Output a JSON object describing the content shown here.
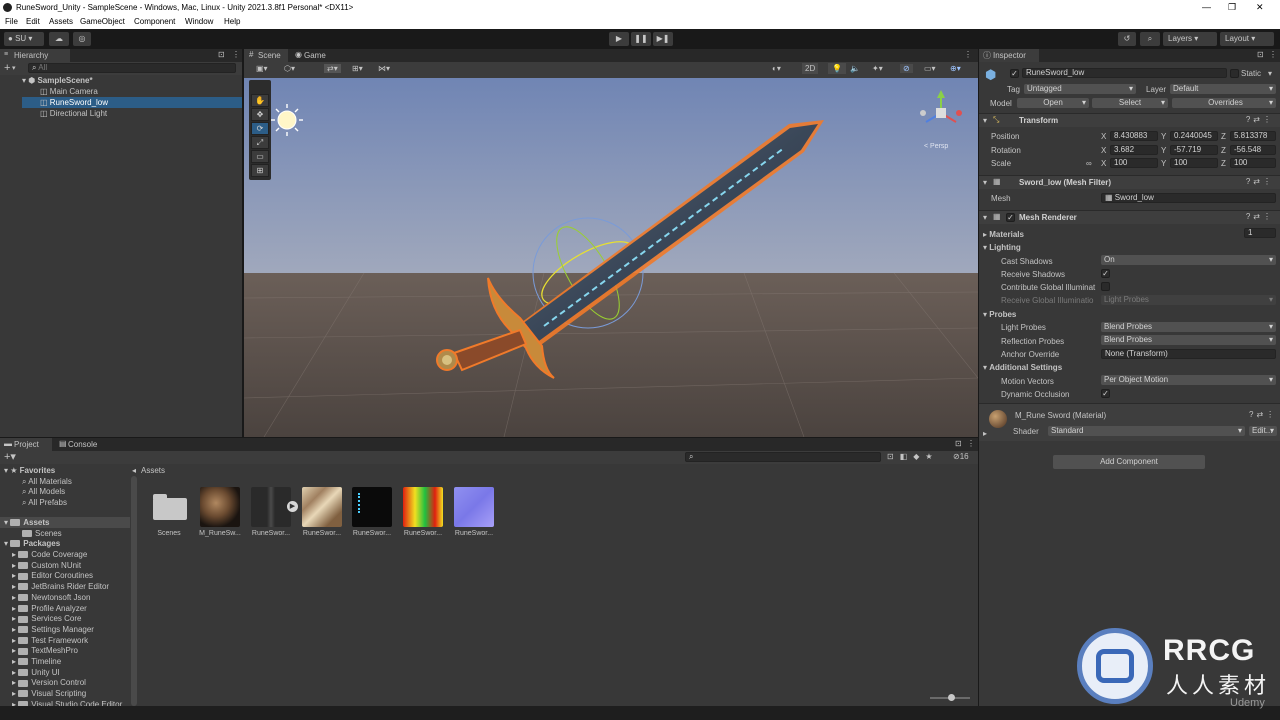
{
  "window": {
    "title": "RuneSword_Unity - SampleScene - Windows, Mac, Linux - Unity 2021.3.8f1 Personal* <DX11>",
    "controls": [
      "—",
      "❐",
      "✕"
    ]
  },
  "menu": [
    "File",
    "Edit",
    "Assets",
    "GameObject",
    "Component",
    "Window",
    "Help"
  ],
  "toolbar": {
    "account": "SU",
    "play_icon": "▶",
    "pause_icon": "❚❚",
    "step_icon": "▶❚",
    "layers": "Layers",
    "layout": "Layout"
  },
  "hierarchy": {
    "tab": "Hierarchy",
    "search_placeholder": "All",
    "scene": "SampleScene*",
    "items": [
      "Main Camera",
      "RuneSword_low",
      "Directional Light"
    ]
  },
  "scene_view": {
    "tabs": [
      "Scene",
      "Game"
    ],
    "mode_2d": "2D",
    "tools": [
      "✋",
      "✥",
      "⟳",
      "⤢",
      "▭",
      "⊞"
    ],
    "gizmo_label": "< Persp"
  },
  "inspector": {
    "tab": "Inspector",
    "object_name": "RuneSword_low",
    "static": "Static",
    "tag_label": "Tag",
    "tag_value": "Untagged",
    "layer_label": "Layer",
    "layer_value": "Default",
    "model_label": "Model",
    "model_buttons": [
      "Open",
      "Select",
      "Overrides"
    ],
    "transform": {
      "title": "Transform",
      "position_label": "Position",
      "rotation_label": "Rotation",
      "scale_label": "Scale",
      "axes": [
        "X",
        "Y",
        "Z"
      ],
      "position": [
        "8.430883",
        "0.2440045",
        "5.813378"
      ],
      "rotation": [
        "3.682",
        "-57.719",
        "-56.548"
      ],
      "scale": [
        "100",
        "100",
        "100"
      ]
    },
    "mesh_filter": {
      "title": "Sword_low (Mesh Filter)",
      "mesh_label": "Mesh",
      "mesh_value": "Sword_low"
    },
    "mesh_renderer": {
      "title": "Mesh Renderer",
      "materials_label": "Materials",
      "materials_count": "1",
      "lighting_label": "Lighting",
      "cast_shadows_label": "Cast Shadows",
      "cast_shadows_value": "On",
      "receive_shadows_label": "Receive Shadows",
      "contribute_gi_label": "Contribute Global Illuminat",
      "receive_gi_label": "Receive Global Illuminatio",
      "receive_gi_value": "Light Probes",
      "probes_label": "Probes",
      "light_probes_label": "Light Probes",
      "light_probes_value": "Blend Probes",
      "reflection_probes_label": "Reflection Probes",
      "reflection_probes_value": "Blend Probes",
      "anchor_override_label": "Anchor Override",
      "anchor_override_value": "None (Transform)",
      "additional_label": "Additional Settings",
      "motion_vectors_label": "Motion Vectors",
      "motion_vectors_value": "Per Object Motion",
      "dynamic_occlusion_label": "Dynamic Occlusion"
    },
    "material": {
      "name": "M_Rune Sword (Material)",
      "shader_label": "Shader",
      "shader_value": "Standard",
      "edit_button": "Edit..."
    },
    "add_component": "Add Component"
  },
  "project": {
    "tabs": [
      "Project",
      "Console"
    ],
    "favorites_label": "Favorites",
    "favorites": [
      "All Materials",
      "All Models",
      "All Prefabs"
    ],
    "assets_label": "Assets",
    "assets_children": [
      "Scenes"
    ],
    "packages_label": "Packages",
    "packages": [
      "Code Coverage",
      "Custom NUnit",
      "Editor Coroutines",
      "JetBrains Rider Editor",
      "Newtonsoft Json",
      "Profile Analyzer",
      "Services Core",
      "Settings Manager",
      "Test Framework",
      "TextMeshPro",
      "Timeline",
      "Unity UI",
      "Version Control",
      "Visual Scripting",
      "Visual Studio Code Editor"
    ],
    "breadcrumb": "Assets",
    "hidden_count": "16",
    "assets": [
      "Scenes",
      "M_RuneSw...",
      "RuneSwor...",
      "RuneSwor...",
      "RuneSwor...",
      "RuneSwor...",
      "RuneSwor..."
    ]
  },
  "watermark": {
    "brand": "RRCG",
    "sub": "人人素材",
    "udemy": "Udemy"
  },
  "colors": {
    "accent_selection": "#2c5d87",
    "panel": "#383838",
    "sky": "#6f84b0",
    "ground": "#5a4f4a",
    "sword_outline": "#f07a2a"
  }
}
